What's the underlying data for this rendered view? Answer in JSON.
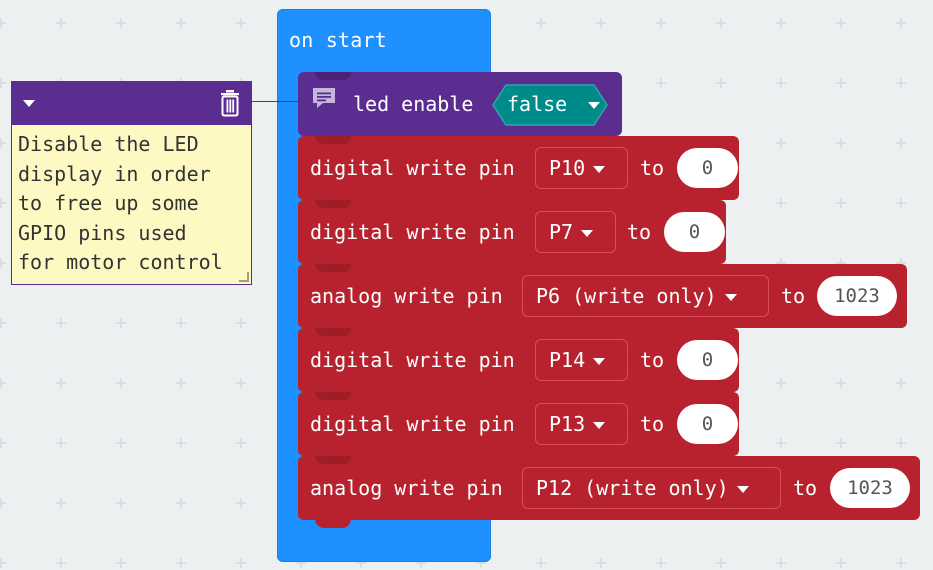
{
  "workspace": {
    "background": "#ecf0f1",
    "grid_color": "#d4d9dc"
  },
  "colors": {
    "basic_blue": "#1e90ff",
    "led_purple": "#5c2d91",
    "pins_red": "#b8222e",
    "logic_teal": "#008b8b",
    "comment_yellow": "#fef9c3"
  },
  "on_start": {
    "label": "on start"
  },
  "comment": {
    "lines": [
      "Disable the LED",
      "display in order",
      "to free up some",
      "GPIO pins used",
      "for motor control"
    ],
    "collapse_icon": "triangle-down-icon",
    "delete_icon": "trash-icon"
  },
  "led_block": {
    "icon": "comment-icon",
    "label": "led enable",
    "value": "false"
  },
  "pin_blocks": [
    {
      "label": "digital write pin",
      "pin": "P10",
      "to": "to",
      "value": "0"
    },
    {
      "label": "digital write pin",
      "pin": "P7",
      "to": "to",
      "value": "0"
    },
    {
      "label": "analog write pin",
      "pin": "P6 (write only)",
      "to": "to",
      "value": "1023"
    },
    {
      "label": "digital write pin",
      "pin": "P14",
      "to": "to",
      "value": "0"
    },
    {
      "label": "digital write pin",
      "pin": "P13",
      "to": "to",
      "value": "0"
    },
    {
      "label": "analog write pin",
      "pin": "P12 (write only)",
      "to": "to",
      "value": "1023"
    }
  ]
}
